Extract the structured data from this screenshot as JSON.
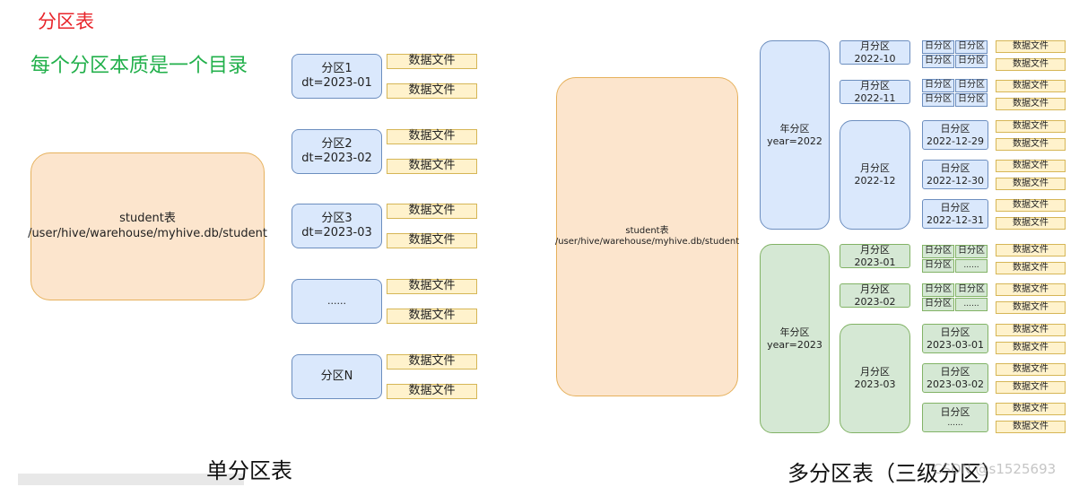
{
  "title": "分区表",
  "subtitle": "每个分区本质是一个目录",
  "left": {
    "caption": "单分区表",
    "table_name": "student表",
    "table_path": "/user/hive/warehouse/myhive.db/student",
    "partitions": [
      {
        "name": "分区1",
        "spec": "dt=2023-01"
      },
      {
        "name": "分区2",
        "spec": "dt=2023-02"
      },
      {
        "name": "分区3",
        "spec": "dt=2023-03"
      },
      {
        "name": "",
        "spec": "......"
      },
      {
        "name": "分区N",
        "spec": ""
      }
    ],
    "file_label": "数据文件"
  },
  "right": {
    "caption": "多分区表（三级分区）",
    "table_name": "student表",
    "table_path": "/user/hive/warehouse/myhive.db/student",
    "years": [
      {
        "name": "年分区",
        "spec": "year=2022"
      },
      {
        "name": "年分区",
        "spec": "year=2023"
      }
    ],
    "months": [
      {
        "name": "月分区",
        "spec": "2022-10"
      },
      {
        "name": "月分区",
        "spec": "2022-11"
      },
      {
        "name": "月分区",
        "spec": "2022-12"
      },
      {
        "name": "月分区",
        "spec": "2023-01"
      },
      {
        "name": "月分区",
        "spec": "2023-02"
      },
      {
        "name": "月分区",
        "spec": "2023-03"
      }
    ],
    "day_label": "日分区",
    "ellipsis": "......",
    "days": [
      {
        "name": "日分区",
        "spec": "2022-12-29"
      },
      {
        "name": "日分区",
        "spec": "2022-12-30"
      },
      {
        "name": "日分区",
        "spec": "2022-12-31"
      },
      {
        "name": "日分区",
        "spec": "2023-03-01"
      },
      {
        "name": "日分区",
        "spec": "2023-03-02"
      },
      {
        "name": "日分区",
        "spec": "......"
      }
    ],
    "file_label": "数据文件"
  },
  "watermark": "CSDN @s1525693"
}
